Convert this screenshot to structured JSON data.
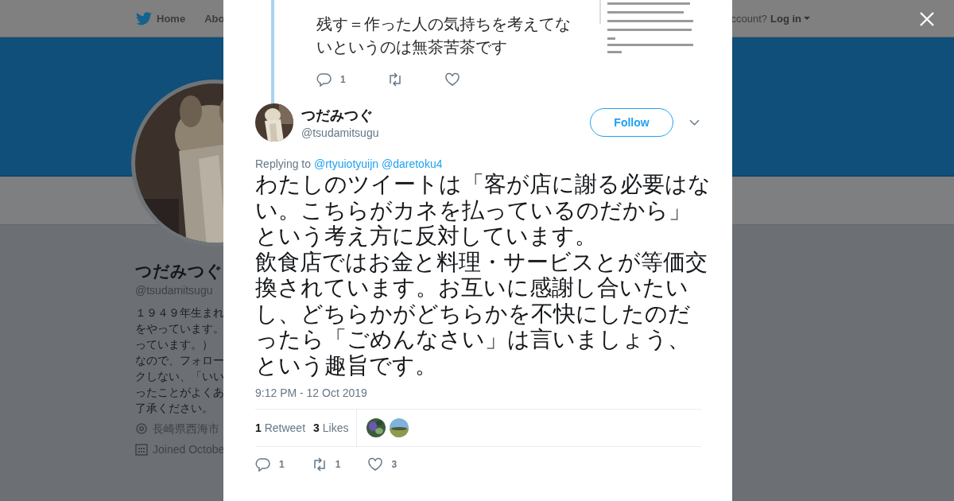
{
  "nav": {
    "items": [
      {
        "label": "Home",
        "kind": "home"
      },
      {
        "label": "Abo",
        "kind": "plain"
      }
    ],
    "account_prompt": "ccount?",
    "login": "Log in"
  },
  "profile": {
    "name": "つだみつぐ",
    "handle": "@tsudamitsugu",
    "bio_lines": [
      "１９４９年生まれ",
      "をやっています。",
      "っています。）",
      "なので、フォロー",
      "クしない、「いい",
      "ったことがよくあ",
      "了承ください。"
    ],
    "location": "長崎県西海市",
    "joined": "Joined Octobe"
  },
  "modal": {
    "previous_tweet": {
      "text_lines": [
        "残す＝作った人の気持ちを考えてな",
        "いというのは無茶苦茶です"
      ],
      "image": {
        "kind": "picture"
      },
      "actions": [
        {
          "kind": "reply",
          "count": "1"
        },
        {
          "kind": "retweet"
        },
        {
          "kind": "like"
        }
      ]
    },
    "tweet": {
      "name": "つだみつぐ",
      "handle": "@tsudamitsugu",
      "follow": "Follow",
      "replying_label": "Replying to",
      "replying_to": [
        "@rtyuiotyuijn",
        "@daretoku4"
      ],
      "text_paragraphs": [
        "わたしのツイートは「客が店に謝る必要はない。こちらがカネを払っているのだから」という考え方に反対しています。",
        "飲食店ではお金と料理・サービスとが等価交換されています。お互いに感謝し合いたいし、どちらかがどちらかを不快にしたのだったら「ごめんなさい」は言いましょう、という趣旨です。"
      ],
      "timestamp": "9:12 PM - 12 Oct 2019",
      "stats": [
        {
          "count": "1",
          "label": "Retweet"
        },
        {
          "count": "3",
          "label": "Likes"
        }
      ],
      "liker_avatars": [
        {
          "kind": "picture"
        },
        {
          "kind": "picture"
        }
      ],
      "actions": [
        {
          "kind": "reply",
          "count": "1"
        },
        {
          "kind": "retweet",
          "count": "1"
        },
        {
          "kind": "like",
          "count": "3"
        }
      ]
    }
  }
}
